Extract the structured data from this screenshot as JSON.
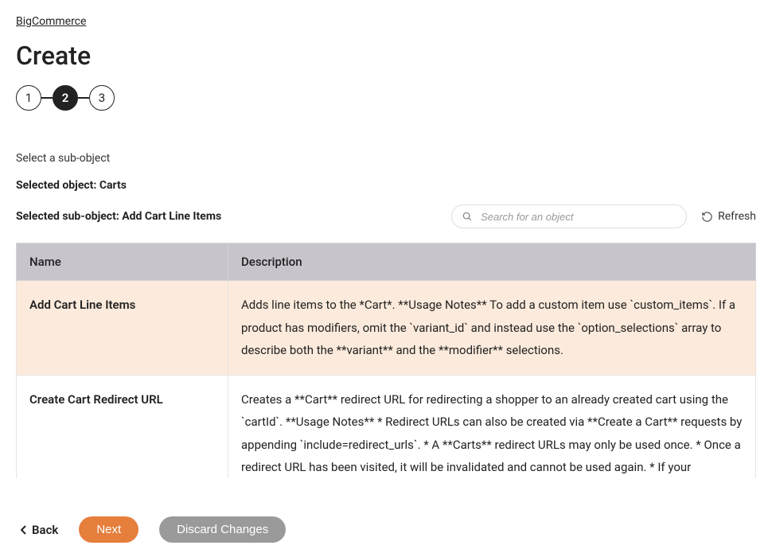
{
  "breadcrumb": {
    "label": "BigCommerce"
  },
  "page": {
    "title": "Create"
  },
  "stepper": {
    "s1": "1",
    "s2": "2",
    "s3": "3"
  },
  "instructions": "Select a sub-object",
  "selected_object": {
    "prefix": "Selected object: ",
    "value": "Carts"
  },
  "selected_sub": {
    "prefix": "Selected sub-object: ",
    "value": "Add Cart Line Items"
  },
  "search": {
    "placeholder": "Search for an object",
    "value": ""
  },
  "refresh_label": "Refresh",
  "table": {
    "headers": {
      "name": "Name",
      "description": "Description"
    },
    "rows": [
      {
        "name": "Add Cart Line Items",
        "description": "Adds line items to the *Cart*. **Usage Notes** To add a custom item use `custom_items`. If a product has modifiers, omit the `variant_id` and instead use the `option_selections` array to describe both the **variant** and the **modifier** selections.",
        "selected": true
      },
      {
        "name": "Create Cart Redirect URL",
        "description": "Creates a **Cart** redirect URL for redirecting a shopper to an already created cart using the `cartId`. **Usage Notes** * Redirect URLs can also be created via **Create a Cart** requests by appending `include=redirect_urls`. * A **Carts** redirect URLs may only be used once. * Once a redirect URL has been visited, it will be invalidated and cannot be used again. * If your application",
        "selected": false
      }
    ]
  },
  "footer": {
    "back": "Back",
    "next": "Next",
    "discard": "Discard Changes"
  }
}
